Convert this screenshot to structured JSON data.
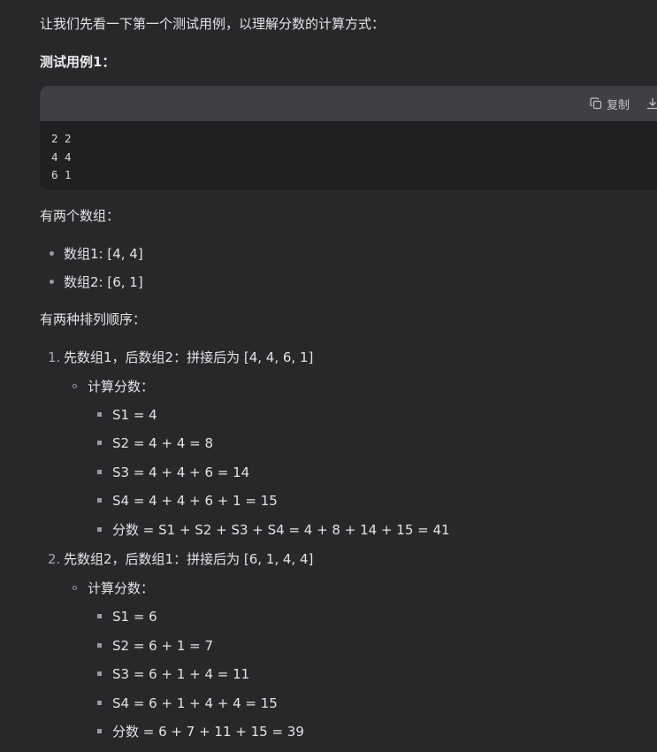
{
  "intro": "让我们先看一下第一个测试用例，以理解分数的计算方式：",
  "test_case_title": "测试用例1：",
  "code_block": {
    "copy_label": "复制",
    "lines": [
      "2 2",
      "4 4",
      "6 1"
    ]
  },
  "arrays_heading": "有两个数组：",
  "arrays": [
    "数组1: [4, 4]",
    "数组2: [6, 1]"
  ],
  "orders_heading": "有两种排列顺序：",
  "orders": [
    {
      "number": "1.",
      "title": "先数组1，后数组2：拼接后为 [4, 4, 6, 1]",
      "sub_label": "计算分数：",
      "steps": [
        "S1 = 4",
        "S2 = 4 + 4 = 8",
        "S3 = 4 + 4 + 6 = 14",
        "S4 = 4 + 4 + 6 + 1 = 15",
        "分数 = S1 + S2 + S3 + S4 = 4 + 8 + 14 + 15 = 41"
      ]
    },
    {
      "number": "2.",
      "title": "先数组2，后数组1：拼接后为 [6, 1, 4, 4]",
      "sub_label": "计算分数：",
      "steps": [
        "S1 = 6",
        "S2 = 6 + 1 = 7",
        "S3 = 6 + 1 + 4 = 11",
        "S4 = 6 + 1 + 4 + 4 = 15",
        "分数 = 6 + 7 + 11 + 15 = 39"
      ]
    }
  ]
}
